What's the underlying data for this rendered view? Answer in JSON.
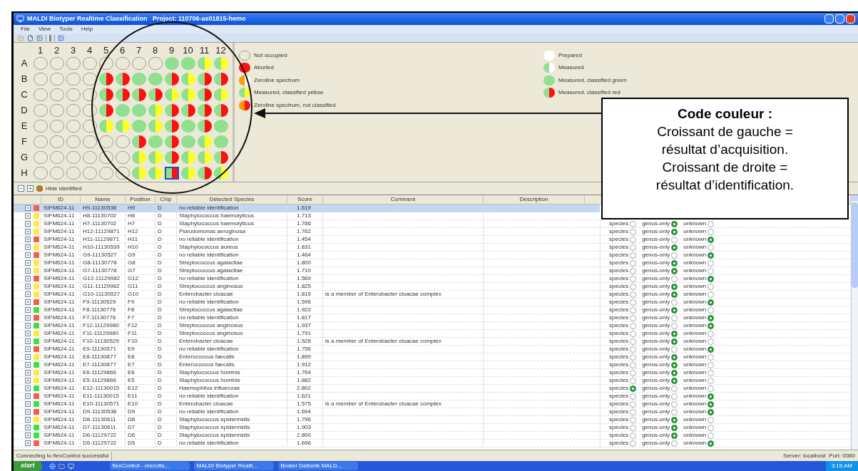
{
  "window": {
    "title": "MALDI Biotyper Realtime Classification   Project: 110706-as01815-hemo"
  },
  "menu": [
    "File",
    "View",
    "Tools",
    "Help"
  ],
  "plate": {
    "columns": [
      "1",
      "2",
      "3",
      "4",
      "5",
      "6",
      "7",
      "8",
      "9",
      "10",
      "11",
      "12"
    ],
    "rows": [
      {
        "label": "A",
        "wells": [
          {
            "kind": "empty",
            "selected": false
          },
          {
            "kind": "empty",
            "selected": false
          },
          {
            "kind": "empty",
            "selected": false
          },
          {
            "kind": "empty",
            "selected": false
          },
          {
            "kind": "empty",
            "selected": false
          },
          {
            "kind": "empty",
            "selected": false
          },
          {
            "kind": "empty",
            "selected": false
          },
          {
            "kind": "empty",
            "selected": false
          },
          {
            "kind": "green",
            "selected": false
          },
          {
            "kind": "green",
            "selected": false
          },
          {
            "kind": "green-yellow",
            "selected": false
          },
          {
            "kind": "green-yellow",
            "selected": false
          }
        ]
      },
      {
        "label": "B",
        "wells": [
          {
            "kind": "empty",
            "selected": false
          },
          {
            "kind": "empty",
            "selected": false
          },
          {
            "kind": "empty",
            "selected": false
          },
          {
            "kind": "empty",
            "selected": false
          },
          {
            "kind": "green-red",
            "selected": false
          },
          {
            "kind": "green-red",
            "selected": false
          },
          {
            "kind": "green",
            "selected": false
          },
          {
            "kind": "green",
            "selected": false
          },
          {
            "kind": "green-red",
            "selected": false
          },
          {
            "kind": "green-yellow",
            "selected": false
          },
          {
            "kind": "green-red",
            "selected": false
          },
          {
            "kind": "green-red",
            "selected": false
          }
        ]
      },
      {
        "label": "C",
        "wells": [
          {
            "kind": "empty",
            "selected": false
          },
          {
            "kind": "empty",
            "selected": false
          },
          {
            "kind": "empty",
            "selected": false
          },
          {
            "kind": "empty",
            "selected": false
          },
          {
            "kind": "green-red",
            "selected": false
          },
          {
            "kind": "green-red",
            "selected": false
          },
          {
            "kind": "green-red",
            "selected": false
          },
          {
            "kind": "green-red",
            "selected": false
          },
          {
            "kind": "green-yellow",
            "selected": false
          },
          {
            "kind": "green-yellow",
            "selected": false
          },
          {
            "kind": "green-red",
            "selected": false
          },
          {
            "kind": "green-yellow",
            "selected": false
          }
        ]
      },
      {
        "label": "D",
        "wells": [
          {
            "kind": "empty",
            "selected": false
          },
          {
            "kind": "empty",
            "selected": false
          },
          {
            "kind": "empty",
            "selected": false
          },
          {
            "kind": "empty",
            "selected": false
          },
          {
            "kind": "green-red",
            "selected": false
          },
          {
            "kind": "green",
            "selected": false
          },
          {
            "kind": "green",
            "selected": false
          },
          {
            "kind": "green-yellow",
            "selected": false
          },
          {
            "kind": "green-red",
            "selected": false
          },
          {
            "kind": "green-red",
            "selected": false
          },
          {
            "kind": "green-red",
            "selected": false
          },
          {
            "kind": "green-red",
            "selected": false
          }
        ]
      },
      {
        "label": "E",
        "wells": [
          {
            "kind": "empty",
            "selected": false
          },
          {
            "kind": "empty",
            "selected": false
          },
          {
            "kind": "empty",
            "selected": false
          },
          {
            "kind": "empty",
            "selected": false
          },
          {
            "kind": "green-yellow",
            "selected": false
          },
          {
            "kind": "green-yellow",
            "selected": false
          },
          {
            "kind": "green",
            "selected": false
          },
          {
            "kind": "green-yellow",
            "selected": false
          },
          {
            "kind": "green-red",
            "selected": false
          },
          {
            "kind": "green",
            "selected": false
          },
          {
            "kind": "green-red",
            "selected": false
          },
          {
            "kind": "green",
            "selected": false
          }
        ]
      },
      {
        "label": "F",
        "wells": [
          {
            "kind": "empty",
            "selected": false
          },
          {
            "kind": "empty",
            "selected": false
          },
          {
            "kind": "empty",
            "selected": false
          },
          {
            "kind": "empty",
            "selected": false
          },
          {
            "kind": "empty",
            "selected": false
          },
          {
            "kind": "empty",
            "selected": false
          },
          {
            "kind": "green-red",
            "selected": false
          },
          {
            "kind": "green",
            "selected": false
          },
          {
            "kind": "green-red",
            "selected": false
          },
          {
            "kind": "green",
            "selected": false
          },
          {
            "kind": "green-yellow",
            "selected": false
          },
          {
            "kind": "green",
            "selected": false
          }
        ]
      },
      {
        "label": "G",
        "wells": [
          {
            "kind": "empty",
            "selected": false
          },
          {
            "kind": "empty",
            "selected": false
          },
          {
            "kind": "empty",
            "selected": false
          },
          {
            "kind": "empty",
            "selected": false
          },
          {
            "kind": "empty",
            "selected": false
          },
          {
            "kind": "empty",
            "selected": false
          },
          {
            "kind": "green-yellow",
            "selected": false
          },
          {
            "kind": "green-yellow",
            "selected": false
          },
          {
            "kind": "green-red",
            "selected": false
          },
          {
            "kind": "green-yellow",
            "selected": false
          },
          {
            "kind": "green-yellow",
            "selected": false
          },
          {
            "kind": "green-red",
            "selected": false
          }
        ]
      },
      {
        "label": "H",
        "wells": [
          {
            "kind": "empty",
            "selected": false
          },
          {
            "kind": "empty",
            "selected": false
          },
          {
            "kind": "empty",
            "selected": false
          },
          {
            "kind": "empty",
            "selected": false
          },
          {
            "kind": "empty",
            "selected": false
          },
          {
            "kind": "empty",
            "selected": false
          },
          {
            "kind": "green-yellow",
            "selected": false
          },
          {
            "kind": "green-yellow",
            "selected": false
          },
          {
            "kind": "green-red",
            "selected": true
          },
          {
            "kind": "green-yellow",
            "selected": false
          },
          {
            "kind": "green-red",
            "selected": false
          },
          {
            "kind": "green-yellow",
            "selected": false
          }
        ]
      }
    ]
  },
  "legend": {
    "left": [
      {
        "kind": "empty",
        "label": "Not occupied"
      },
      {
        "kind": "red",
        "label": "Aborted"
      },
      {
        "kind": "orange-white",
        "label": "Zeroline spectrum"
      },
      {
        "kind": "green-yellow",
        "label": "Measured, classified yellow"
      },
      {
        "kind": "orange-red",
        "label": "Zeroline spectrum, not classified"
      }
    ],
    "right": [
      {
        "kind": "white",
        "label": "Prepared"
      },
      {
        "kind": "green-white",
        "label": "Measured"
      },
      {
        "kind": "green",
        "label": "Measured, classified green"
      },
      {
        "kind": "green-red",
        "label": "Measured, classified red"
      }
    ]
  },
  "callout": {
    "title": "Code couleur :",
    "lines": [
      "Croissant de gauche =",
      "résultat d’acquisition.",
      "Croissant de droite =",
      "résultat d’identification."
    ]
  },
  "table_toolbar": {
    "label": "Hide identified"
  },
  "table": {
    "columns": [
      "ID",
      "Name",
      "Position",
      "Chip",
      "Detected Species",
      "Score",
      "Comment",
      "Description"
    ],
    "rows": [
      {
        "selected": true,
        "color": "#f06050",
        "id": "SIFM624-11",
        "name": "H9-11130538",
        "position": "H9",
        "chip": "D",
        "species": "no reliable identification",
        "score": "1.619"
      },
      {
        "selected": false,
        "color": "#ffe840",
        "id": "SIFM624-11",
        "name": "H8-11130702",
        "position": "H8",
        "chip": "D",
        "species": "Staphylococcus haemolyticus",
        "score": "1.713"
      },
      {
        "selected": false,
        "color": "#ffe840",
        "id": "SIFM624-11",
        "name": "H7-11130702",
        "position": "H7",
        "chip": "D",
        "species": "Staphylococcus haemolyticus",
        "score": "1.786",
        "options": [
          {
            "label": "species",
            "checked": false
          },
          {
            "label": "genus-only",
            "checked": true
          },
          {
            "label": "unknown",
            "checked": false
          }
        ]
      },
      {
        "selected": false,
        "color": "#ffe840",
        "id": "SIFM624-11",
        "name": "H12-11129871",
        "position": "H12",
        "chip": "D",
        "species": "Pseudomonas aeruginosa",
        "score": "1.762",
        "options": [
          {
            "label": "species",
            "checked": false
          },
          {
            "label": "genus-only",
            "checked": true
          },
          {
            "label": "unknown",
            "checked": false
          }
        ]
      },
      {
        "selected": false,
        "color": "#f06050",
        "id": "SIFM624-11",
        "name": "H11-11129871",
        "position": "H11",
        "chip": "D",
        "species": "no reliable identification",
        "score": "1.454",
        "options": [
          {
            "label": "species",
            "checked": false
          },
          {
            "label": "genus-only",
            "checked": false
          },
          {
            "label": "unknown",
            "checked": true
          }
        ]
      },
      {
        "selected": false,
        "color": "#ffe840",
        "id": "SIFM624-11",
        "name": "H10-11130539",
        "position": "H10",
        "chip": "D",
        "species": "Staphylococcus aureus",
        "score": "1.831",
        "options": [
          {
            "label": "species",
            "checked": false
          },
          {
            "label": "genus-only",
            "checked": true
          },
          {
            "label": "unknown",
            "checked": false
          }
        ]
      },
      {
        "selected": false,
        "color": "#f06050",
        "id": "SIFM624-11",
        "name": "G9-11130527",
        "position": "G9",
        "chip": "D",
        "species": "no reliable identification",
        "score": "1.464",
        "options": [
          {
            "label": "species",
            "checked": false
          },
          {
            "label": "genus-only",
            "checked": false
          },
          {
            "label": "unknown",
            "checked": true
          }
        ]
      },
      {
        "selected": false,
        "color": "#ffe840",
        "id": "SIFM624-11",
        "name": "G8-11130778",
        "position": "G8",
        "chip": "D",
        "species": "Streptococcus agalactiae",
        "score": "1.800",
        "options": [
          {
            "label": "species",
            "checked": false
          },
          {
            "label": "genus-only",
            "checked": true
          },
          {
            "label": "unknown",
            "checked": false
          }
        ]
      },
      {
        "selected": false,
        "color": "#ffe840",
        "id": "SIFM624-11",
        "name": "G7-11130778",
        "position": "G7",
        "chip": "D",
        "species": "Streptococcus agalactiae",
        "score": "1.710",
        "options": [
          {
            "label": "species",
            "checked": false
          },
          {
            "label": "genus-only",
            "checked": true
          },
          {
            "label": "unknown",
            "checked": false
          }
        ]
      },
      {
        "selected": false,
        "color": "#f06050",
        "id": "SIFM624-11",
        "name": "G12-11129982",
        "position": "G12",
        "chip": "D",
        "species": "no reliable identification",
        "score": "1.569",
        "options": [
          {
            "label": "species",
            "checked": false
          },
          {
            "label": "genus-only",
            "checked": false
          },
          {
            "label": "unknown",
            "checked": true
          }
        ]
      },
      {
        "selected": false,
        "color": "#ffe840",
        "id": "SIFM624-11",
        "name": "G11-11129982",
        "position": "G11",
        "chip": "D",
        "species": "Streptococcus anginosus",
        "score": "1.825",
        "options": [
          {
            "label": "species",
            "checked": false
          },
          {
            "label": "genus-only",
            "checked": true
          },
          {
            "label": "unknown",
            "checked": false
          }
        ]
      },
      {
        "selected": false,
        "color": "#ffe840",
        "id": "SIFM624-11",
        "name": "G10-11130527",
        "position": "G10",
        "chip": "D",
        "species": "Enterobacter cloacae",
        "score": "1.815",
        "comment": "is a member of Enterobacter cloacae complex",
        "options": [
          {
            "label": "species",
            "checked": false
          },
          {
            "label": "genus-only",
            "checked": true
          },
          {
            "label": "unknown",
            "checked": false
          }
        ]
      },
      {
        "selected": false,
        "color": "#f06050",
        "id": "SIFM624-11",
        "name": "F9-11130529",
        "position": "F9",
        "chip": "D",
        "species": "no reliable identification",
        "score": "1.596",
        "options": [
          {
            "label": "species",
            "checked": false
          },
          {
            "label": "genus-only",
            "checked": false
          },
          {
            "label": "unknown",
            "checked": true
          }
        ]
      },
      {
        "selected": false,
        "color": "#40e040",
        "id": "SIFM624-11",
        "name": "F8-11130776",
        "position": "F8",
        "chip": "D",
        "species": "Streptococcus agalactiae",
        "score": "1.922",
        "options": [
          {
            "label": "species",
            "checked": false
          },
          {
            "label": "genus-only",
            "checked": true
          },
          {
            "label": "unknown",
            "checked": false
          }
        ]
      },
      {
        "selected": false,
        "color": "#f06050",
        "id": "SIFM624-11",
        "name": "F7-11130776",
        "position": "F7",
        "chip": "D",
        "species": "no reliable identification",
        "score": "1.817",
        "options": [
          {
            "label": "species",
            "checked": false
          },
          {
            "label": "genus-only",
            "checked": false
          },
          {
            "label": "unknown",
            "checked": true
          }
        ]
      },
      {
        "selected": false,
        "color": "#40e040",
        "id": "SIFM624-11",
        "name": "F12-11129980",
        "position": "F12",
        "chip": "D",
        "species": "Streptococcus anginosus",
        "score": "1.937",
        "options": [
          {
            "label": "species",
            "checked": false
          },
          {
            "label": "genus-only",
            "checked": false
          },
          {
            "label": "unknown",
            "checked": true
          }
        ]
      },
      {
        "selected": false,
        "color": "#ffe840",
        "id": "SIFM624-11",
        "name": "F11-11129980",
        "position": "F11",
        "chip": "D",
        "species": "Streptococcus anginosus",
        "score": "1.791",
        "options": [
          {
            "label": "species",
            "checked": false
          },
          {
            "label": "genus-only",
            "checked": true
          },
          {
            "label": "unknown",
            "checked": false
          }
        ]
      },
      {
        "selected": false,
        "color": "#40e040",
        "id": "SIFM624-11",
        "name": "F10-11130529",
        "position": "F10",
        "chip": "D",
        "species": "Enterobacter cloacae",
        "score": "1.528",
        "comment": "is a member of Enterobacter cloacae complex",
        "options": [
          {
            "label": "species",
            "checked": false
          },
          {
            "label": "genus-only",
            "checked": true
          },
          {
            "label": "unknown",
            "checked": false
          }
        ]
      },
      {
        "selected": false,
        "color": "#f06050",
        "id": "SIFM624-11",
        "name": "E9-11130571",
        "position": "E9",
        "chip": "D",
        "species": "no reliable identification",
        "score": "1.756",
        "options": [
          {
            "label": "species",
            "checked": false
          },
          {
            "label": "genus-only",
            "checked": false
          },
          {
            "label": "unknown",
            "checked": true
          }
        ]
      },
      {
        "selected": false,
        "color": "#ffe840",
        "id": "SIFM624-11",
        "name": "E8-11130877",
        "position": "E8",
        "chip": "D",
        "species": "Enterococcus faecalis",
        "score": "1.899",
        "options": [
          {
            "label": "species",
            "checked": false
          },
          {
            "label": "genus-only",
            "checked": true
          },
          {
            "label": "unknown",
            "checked": false
          }
        ]
      },
      {
        "selected": false,
        "color": "#40e040",
        "id": "SIFM624-11",
        "name": "E7-11130877",
        "position": "E7",
        "chip": "D",
        "species": "Enterococcus faecalis",
        "score": "1.912",
        "options": [
          {
            "label": "species",
            "checked": false
          },
          {
            "label": "genus-only",
            "checked": true
          },
          {
            "label": "unknown",
            "checked": false
          }
        ]
      },
      {
        "selected": false,
        "color": "#ffe840",
        "id": "SIFM624-11",
        "name": "E6-11129866",
        "position": "E6",
        "chip": "D",
        "species": "Staphylococcus hominis",
        "score": "1.764",
        "options": [
          {
            "label": "species",
            "checked": false
          },
          {
            "label": "genus-only",
            "checked": true
          },
          {
            "label": "unknown",
            "checked": false
          }
        ]
      },
      {
        "selected": false,
        "color": "#ffe840",
        "id": "SIFM624-11",
        "name": "E5-11129866",
        "position": "E5",
        "chip": "D",
        "species": "Staphylococcus hominis",
        "score": "1.882",
        "options": [
          {
            "label": "species",
            "checked": false
          },
          {
            "label": "genus-only",
            "checked": true
          },
          {
            "label": "unknown",
            "checked": false
          }
        ]
      },
      {
        "selected": false,
        "color": "#40e040",
        "id": "SIFM624-11",
        "name": "E12-11130015",
        "position": "E12",
        "chip": "D",
        "species": "Haemophilus influenzae",
        "score": "2.802",
        "options": [
          {
            "label": "species",
            "checked": true
          },
          {
            "label": "genus-only",
            "checked": false
          },
          {
            "label": "unknown",
            "checked": false
          }
        ]
      },
      {
        "selected": false,
        "color": "#f06050",
        "id": "SIFM624-11",
        "name": "E11-11130015",
        "position": "E11",
        "chip": "D",
        "species": "no reliable identification",
        "score": "1.621",
        "options": [
          {
            "label": "species",
            "checked": false
          },
          {
            "label": "genus-only",
            "checked": false
          },
          {
            "label": "unknown",
            "checked": true
          }
        ]
      },
      {
        "selected": false,
        "color": "#40e040",
        "id": "SIFM624-11",
        "name": "E10-11130571",
        "position": "E10",
        "chip": "D",
        "species": "Enterobacter cloacae",
        "score": "1.575",
        "comment": "is a member of Enterobacter cloacae complex",
        "options": [
          {
            "label": "species",
            "checked": false
          },
          {
            "label": "genus-only",
            "checked": false
          },
          {
            "label": "unknown",
            "checked": true
          }
        ]
      },
      {
        "selected": false,
        "color": "#f06050",
        "id": "SIFM624-11",
        "name": "D9-11130538",
        "position": "D9",
        "chip": "D",
        "species": "no reliable identification",
        "score": "1.694",
        "options": [
          {
            "label": "species",
            "checked": false
          },
          {
            "label": "genus-only",
            "checked": false
          },
          {
            "label": "unknown",
            "checked": true
          }
        ]
      },
      {
        "selected": false,
        "color": "#ffe840",
        "id": "SIFM624-11",
        "name": "D8-11130611",
        "position": "D8",
        "chip": "D",
        "species": "Staphylococcus epidermidis",
        "score": "1.796",
        "options": [
          {
            "label": "species",
            "checked": false
          },
          {
            "label": "genus-only",
            "checked": true
          },
          {
            "label": "unknown",
            "checked": false
          }
        ]
      },
      {
        "selected": false,
        "color": "#40e040",
        "id": "SIFM624-11",
        "name": "D7-11130611",
        "position": "D7",
        "chip": "D",
        "species": "Staphylococcus epidermidis",
        "score": "1.903",
        "options": [
          {
            "label": "species",
            "checked": false
          },
          {
            "label": "genus-only",
            "checked": true
          },
          {
            "label": "unknown",
            "checked": false
          }
        ]
      },
      {
        "selected": false,
        "color": "#40e040",
        "id": "SIFM624-11",
        "name": "D6-11129722",
        "position": "D6",
        "chip": "D",
        "species": "Staphylococcus epidermidis",
        "score": "2.800",
        "options": [
          {
            "label": "species",
            "checked": false
          },
          {
            "label": "genus-only",
            "checked": true
          },
          {
            "label": "unknown",
            "checked": false
          }
        ]
      },
      {
        "selected": false,
        "color": "#f06050",
        "id": "SIFM624-11",
        "name": "D5-11129722",
        "position": "D5",
        "chip": "D",
        "species": "no reliable identification",
        "score": "1.696",
        "options": [
          {
            "label": "species",
            "checked": false
          },
          {
            "label": "genus-only",
            "checked": false
          },
          {
            "label": "unknown",
            "checked": true
          }
        ]
      }
    ]
  },
  "status_bar": {
    "left": "Connecting to flexControl successful",
    "right": "Server: localhost  Port: 0080"
  },
  "taskbar": {
    "start": "start",
    "tasks": [
      "flexControl - microfle...",
      "MALDI Biotyper Realti...",
      "Bruker Daltonik MALD..."
    ],
    "clock": "3:15 AM"
  }
}
